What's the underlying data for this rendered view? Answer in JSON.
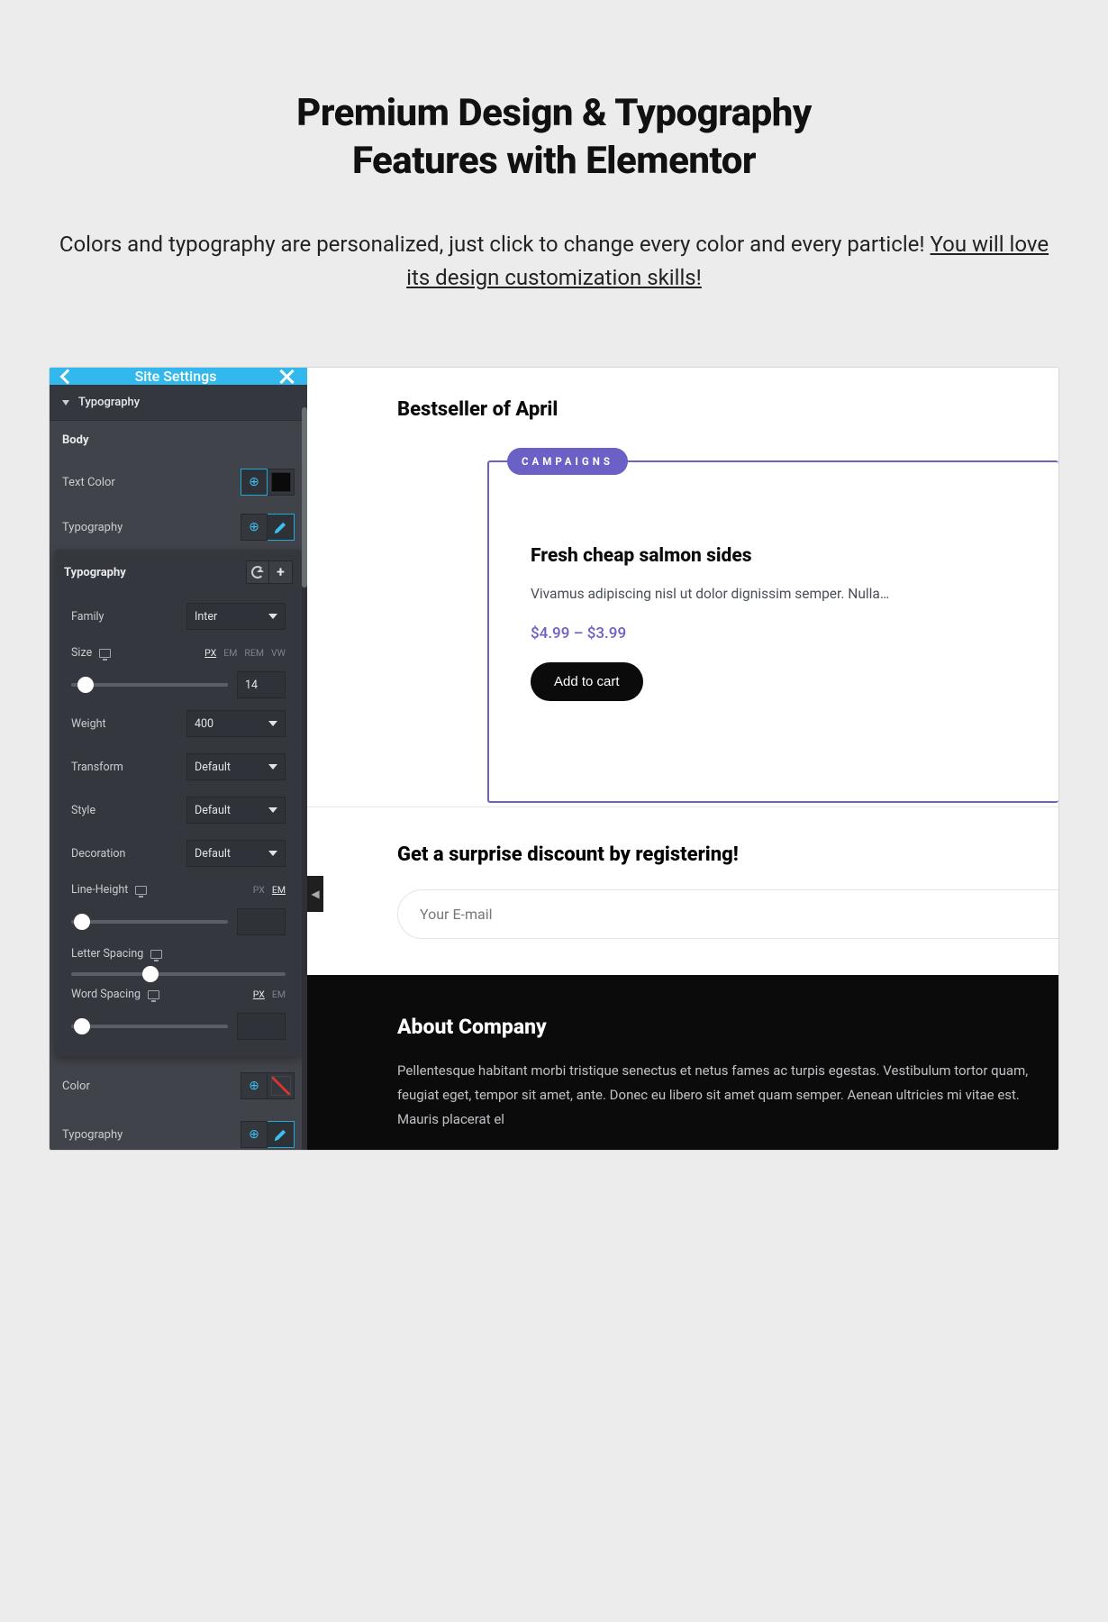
{
  "hero": {
    "title_l1": "Premium Design & Typography",
    "title_l2": "Features with Elementor",
    "lead_a": "Colors and typography are personalized, just click to change every color and every particle! ",
    "lead_u": "You will love its design customization skills!"
  },
  "sidebar": {
    "title": "Site Settings",
    "accordion": "Typography",
    "body_label": "Body",
    "text_color": "Text Color",
    "typography_label": "Typography",
    "popup": {
      "title": "Typography",
      "family": {
        "label": "Family",
        "value": "Inter"
      },
      "size": {
        "label": "Size",
        "units": [
          "PX",
          "EM",
          "REM",
          "VW"
        ],
        "active_unit": "PX",
        "value": "14",
        "thumb_pct": 4
      },
      "weight": {
        "label": "Weight",
        "value": "400"
      },
      "transform": {
        "label": "Transform",
        "value": "Default"
      },
      "style": {
        "label": "Style",
        "value": "Default"
      },
      "decoration": {
        "label": "Decoration",
        "value": "Default"
      },
      "lineheight": {
        "label": "Line-Height",
        "units": [
          "PX",
          "EM"
        ],
        "active_unit": "EM",
        "value": "",
        "thumb_pct": 2
      },
      "letterspacing": {
        "label": "Letter Spacing",
        "thumb_pct": 33
      },
      "wordspacing": {
        "label": "Word Spacing",
        "units": [
          "PX",
          "EM"
        ],
        "active_unit": "PX",
        "value": "",
        "thumb_pct": 2
      }
    },
    "color": "Color",
    "typography2": "Typography"
  },
  "preview": {
    "bestseller": "Bestseller of April",
    "badge": "CAMPAIGNS",
    "product_title": "Fresh cheap salmon sides",
    "product_desc": "Vivamus adipiscing nisl ut dolor dignissim semper. Nulla…",
    "price": "$4.99 – $3.99",
    "cart": "Add to cart",
    "subscribe_title": "Get a surprise discount by registering!",
    "email_placeholder": "Your E-mail",
    "about_title": "About Company",
    "about_body": "Pellentesque habitant morbi tristique senectus et netus fames ac turpis egestas. Vestibulum tortor quam, feugiat eget, tempor sit amet, ante. Donec eu libero sit amet quam semper. Aenean ultricies mi vitae est. Mauris placerat el"
  }
}
